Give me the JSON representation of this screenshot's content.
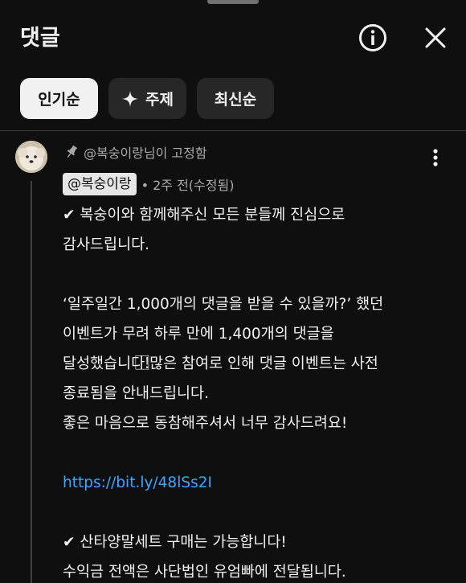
{
  "header": {
    "title": "댓글",
    "info_icon": "info-circle-icon",
    "close_icon": "close-icon"
  },
  "chips": [
    {
      "label": "인기순"
    },
    {
      "label": "주제",
      "icon": "sparkle-icon"
    },
    {
      "label": "최신순"
    }
  ],
  "comment": {
    "pinned_text": "@복숭이랑님이 고정함",
    "author": "@복숭이랑",
    "meta": "• 2주 전(수정됨)",
    "lines": [
      "✔ 복숭이와 함께해주신 모든 분들께 진심으로",
      "감사드립니다.",
      "",
      "‘일주일간 1,000개의 댓글을 받을 수 있을까?’ 했던",
      "이벤트가 무려 하루 만에 1,400개의 댓글을",
      "달성했습니다!⃞많은 참여로 인해 댓글 이벤트는 사전",
      "종료됨을 안내드립니다.",
      "좋은 마음으로 동참해주셔서 너무 감사드려요!",
      "",
      "https://bit.ly/48lSs2I",
      "",
      "✔ 산타양말세트 구매는 가능합니다!",
      " 수익금 전액은 사단법인 유엄빠에 전달됩니다."
    ],
    "link_line_index": 9
  },
  "colors": {
    "background": "#0f0f0f",
    "chip_selected": "#f1f1f1",
    "chip": "#272727",
    "link": "#3ea6ff",
    "secondary_text": "#aaaaaa"
  }
}
